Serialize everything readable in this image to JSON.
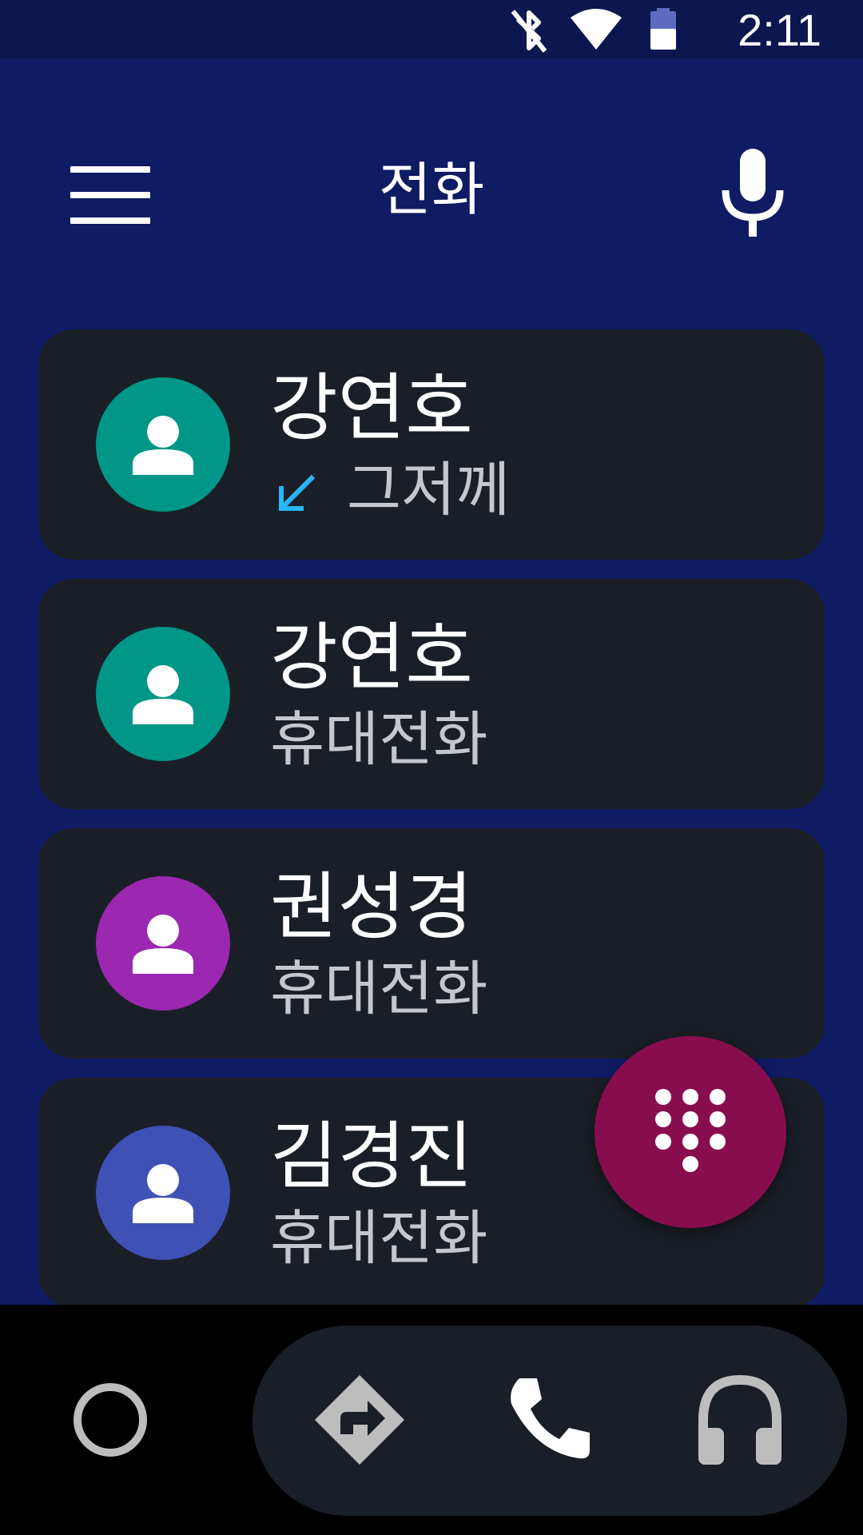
{
  "status_bar": {
    "time": "2:11",
    "icons": [
      "bluetooth-off-icon",
      "wifi-icon",
      "battery-icon"
    ]
  },
  "app_bar": {
    "title": "전화",
    "left_icon": "menu-icon",
    "right_icon": "mic-icon"
  },
  "call_list": [
    {
      "name": "강연호",
      "detail": "그저께",
      "detail_icon": "incoming-call-icon",
      "avatar_color": "#009688"
    },
    {
      "name": "강연호",
      "detail": "휴대전화",
      "avatar_color": "#009688"
    },
    {
      "name": "권성경",
      "detail": "휴대전화",
      "avatar_color": "#9c27b0"
    },
    {
      "name": "김경진",
      "detail": "휴대전화",
      "avatar_color": "#3f51b5"
    }
  ],
  "fab": {
    "icon": "dialpad-icon",
    "color": "#880d4e"
  },
  "bottom_nav": {
    "items": [
      "home-icon",
      "navigation-icon",
      "phone-icon",
      "headphones-icon"
    ]
  },
  "colors": {
    "background": "#0f1c63",
    "status_bar": "#0b174e",
    "card": "#1a1f27",
    "incoming_arrow": "#29b6f6",
    "secondary_text": "#c4c7cc"
  }
}
